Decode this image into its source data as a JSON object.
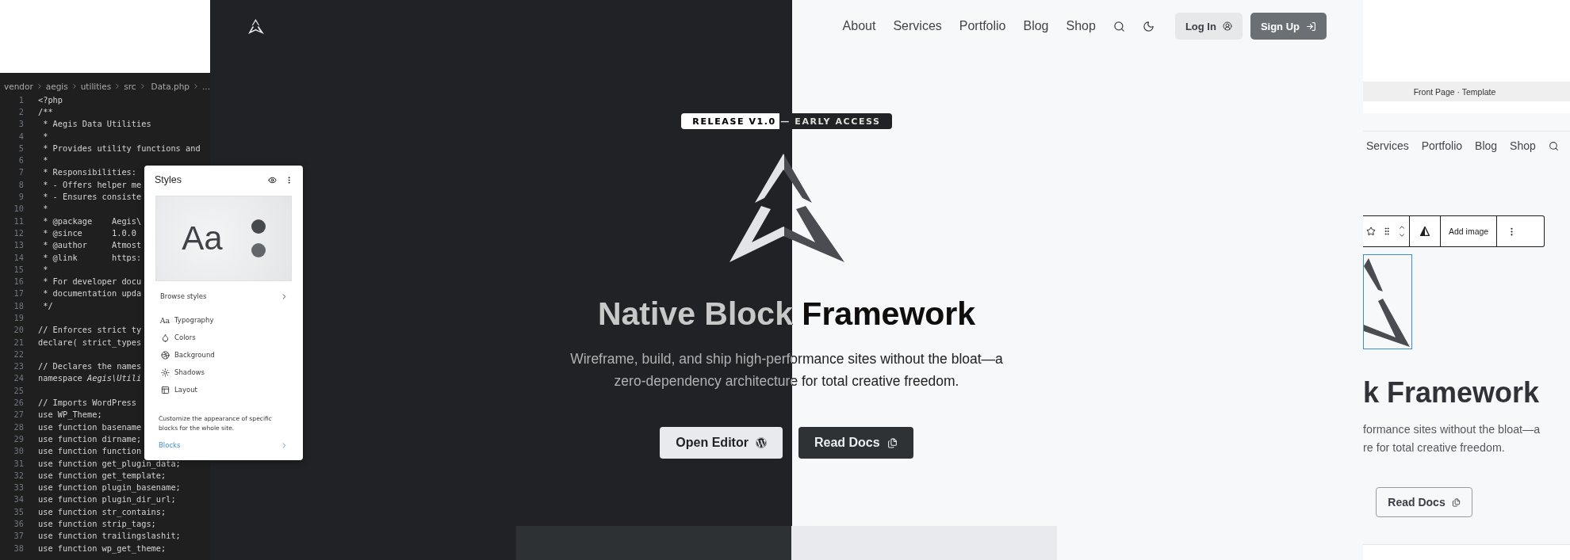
{
  "editor": {
    "breadcrumb": [
      "vendor",
      "aegis",
      "utilities",
      "src",
      "Data.php",
      "..."
    ],
    "lines": [
      {
        "number": "1",
        "text": "<?php"
      },
      {
        "number": "2",
        "text": "/**"
      },
      {
        "number": "3",
        "text": " * Aegis Data Utilities"
      },
      {
        "number": "4",
        "text": " *"
      },
      {
        "number": "5",
        "text": " * Provides utility functions and"
      },
      {
        "number": "6",
        "text": " *"
      },
      {
        "number": "7",
        "text": " * Responsibilities:"
      },
      {
        "number": "8",
        "text": " * - Offers helper me"
      },
      {
        "number": "9",
        "text": " * - Ensures consiste"
      },
      {
        "number": "10",
        "text": " *"
      },
      {
        "number": "11",
        "text": " * @package    Aegis\\"
      },
      {
        "number": "12",
        "text": " * @since      1.0.0"
      },
      {
        "number": "13",
        "text": " * @author     Atmost"
      },
      {
        "number": "14",
        "text": " * @link       https:"
      },
      {
        "number": "15",
        "text": " *"
      },
      {
        "number": "16",
        "text": " * For developer docu"
      },
      {
        "number": "17",
        "text": " * documentation upda"
      },
      {
        "number": "18",
        "text": " */"
      },
      {
        "number": "19"
      },
      {
        "number": "20",
        "text": "// Enforces strict ty"
      },
      {
        "number": "21",
        "text": "declare( strict_types"
      },
      {
        "number": "22"
      },
      {
        "number": "23",
        "text": "// Declares the names"
      },
      {
        "number": "24",
        "text": "namespace *Aegis\\Utili*"
      },
      {
        "number": "25"
      },
      {
        "number": "26",
        "text": "// Imports WordPress"
      },
      {
        "number": "27",
        "text": "use WP_Theme;"
      },
      {
        "number": "28",
        "text": "use function basename"
      },
      {
        "number": "29",
        "text": "use function dirname;"
      },
      {
        "number": "30",
        "text": "use function function"
      },
      {
        "number": "31",
        "text": "use function get_plugin_data;"
      },
      {
        "number": "32",
        "text": "use function get_template;"
      },
      {
        "number": "33",
        "text": "use function plugin_basename;"
      },
      {
        "number": "34",
        "text": "use function plugin_dir_url;"
      },
      {
        "number": "35",
        "text": "use function str_contains;"
      },
      {
        "number": "36",
        "text": "use function strip_tags;"
      },
      {
        "number": "37",
        "text": "use function trailingslashit;"
      },
      {
        "number": "38",
        "text": "use function wp_get_theme;"
      }
    ]
  },
  "styles_panel": {
    "title": "Styles",
    "preview_text": "Aa",
    "browse": "Browse styles",
    "items": [
      {
        "kind": "typography",
        "icon_text": "Aa",
        "label": "Typography"
      },
      {
        "kind": "colors",
        "label": "Colors"
      },
      {
        "kind": "background",
        "label": "Background"
      },
      {
        "kind": "shadows",
        "label": "Shadows"
      },
      {
        "kind": "layout",
        "label": "Layout"
      }
    ],
    "description": "Customize the appearance of specific blocks for the whole site.",
    "link": "Blocks"
  },
  "hero": {
    "nav": {
      "links": [
        "About",
        "Services",
        "Portfolio",
        "Blog",
        "Shop"
      ],
      "login": "Log In",
      "signup": "Sign Up"
    },
    "badge": "RELEASE V1.0 — EARLY ACCESS",
    "title": "Native Block Framework",
    "subtitle_lines": [
      "Wireframe, build, and ship high-performance sites without the bloat—a",
      "zero-dependency architecture for total creative freedom."
    ],
    "buttons": [
      {
        "kind": "editor",
        "label": "Open Editor"
      },
      {
        "kind": "docs",
        "label": "Read Docs"
      }
    ]
  },
  "editor_preview": {
    "template_bar": "Front Page · Template",
    "nav_links": [
      "Services",
      "Portfolio",
      "Blog",
      "Shop"
    ],
    "toolbar_label": "Add image",
    "title": "k Framework",
    "subtitle_lines": [
      "formance sites without the bloat—a",
      "re for total creative freedom."
    ],
    "button": "Read Docs"
  }
}
